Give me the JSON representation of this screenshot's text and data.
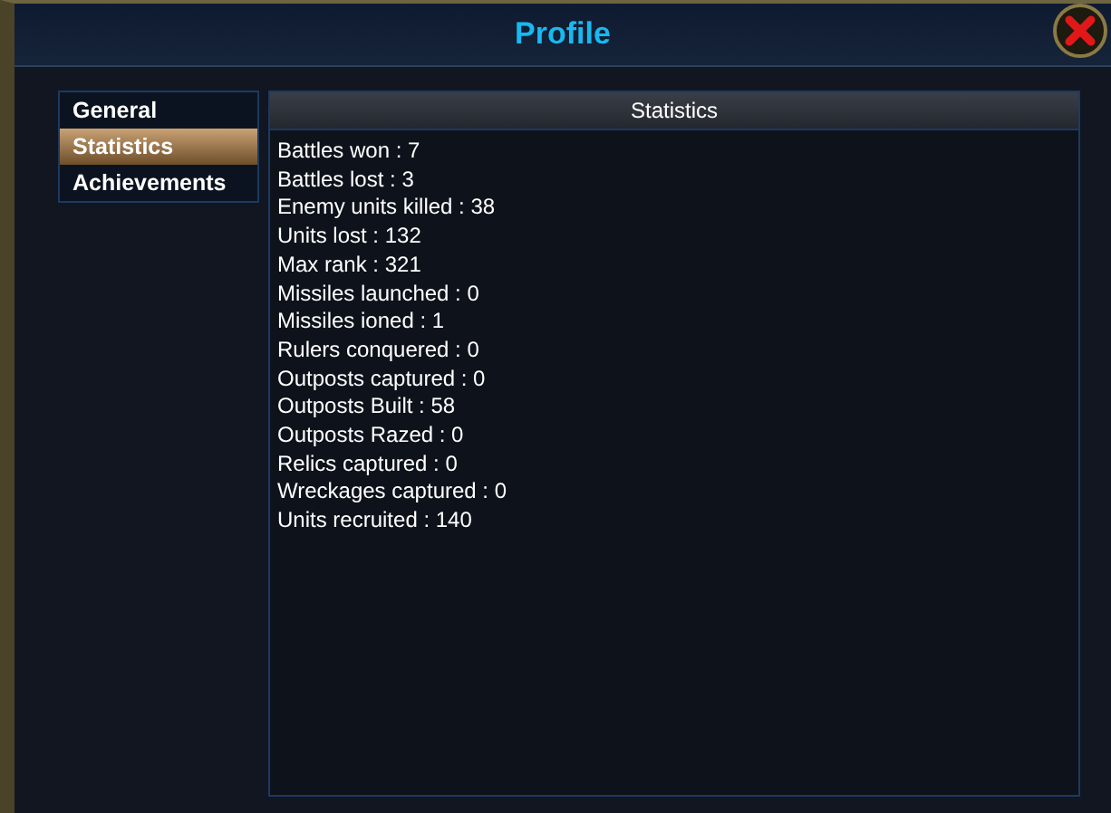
{
  "window": {
    "title": "Profile"
  },
  "tabs": [
    {
      "label": "General",
      "selected": false
    },
    {
      "label": "Statistics",
      "selected": true
    },
    {
      "label": "Achievements",
      "selected": false
    }
  ],
  "panel": {
    "title": "Statistics",
    "lines": [
      "Battles won : 7",
      "Battles lost : 3",
      "Enemy units killed : 38",
      "Units lost : 132",
      "Max rank : 321",
      "Missiles launched : 0",
      "Missiles ioned : 1",
      "Rulers conquered : 0",
      "Outposts captured : 0",
      "Outposts Built : 58",
      "Outposts Razed : 0",
      "Relics captured : 0",
      "Wreckages captured : 0",
      "Units recruited : 140"
    ]
  }
}
